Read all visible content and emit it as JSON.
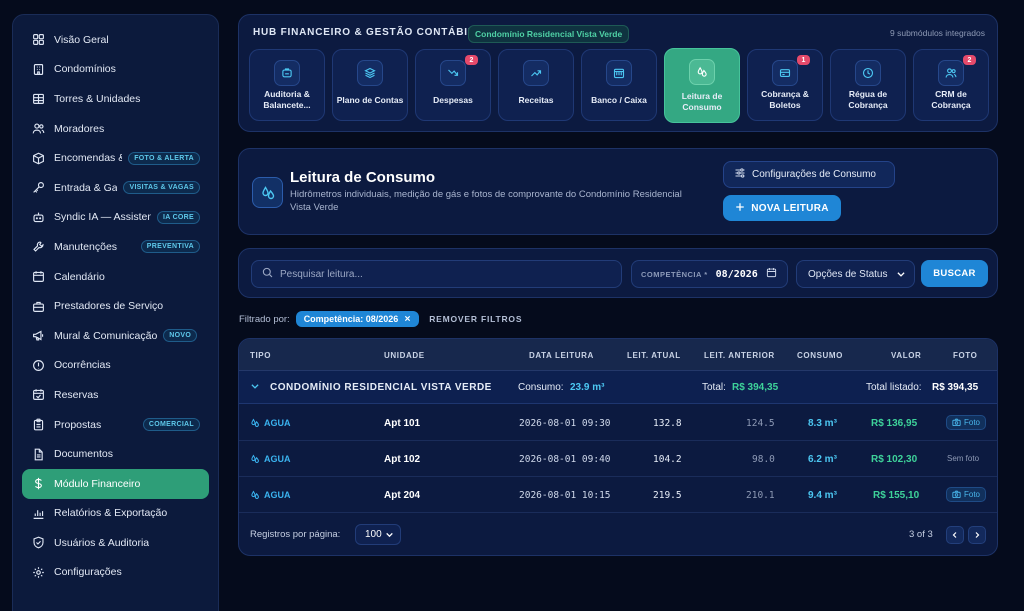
{
  "sidebar": {
    "items": [
      {
        "label": "Visão Geral",
        "icon": "grid-icon"
      },
      {
        "label": "Condomínios",
        "icon": "building-icon"
      },
      {
        "label": "Torres & Unidades",
        "icon": "tower-icon"
      },
      {
        "label": "Moradores",
        "icon": "users-icon"
      },
      {
        "label": "Encomendas &...",
        "icon": "package-icon",
        "badge": "FOTO & ALERTA"
      },
      {
        "label": "Entrada & Gar...",
        "icon": "key-icon",
        "badge": "VISITAS & VAGAS"
      },
      {
        "label": "Syndic IA — Assistente",
        "icon": "bot-icon",
        "badge": "IA CORE"
      },
      {
        "label": "Manutenções",
        "icon": "wrench-icon",
        "badge": "PREVENTIVA"
      },
      {
        "label": "Calendário",
        "icon": "calendar-icon"
      },
      {
        "label": "Prestadores de Serviço",
        "icon": "briefcase-icon"
      },
      {
        "label": "Mural & Comunicação",
        "icon": "megaphone-icon",
        "badge": "NOVO"
      },
      {
        "label": "Ocorrências",
        "icon": "alert-icon"
      },
      {
        "label": "Reservas",
        "icon": "calendar-check-icon"
      },
      {
        "label": "Propostas",
        "icon": "clipboard-icon",
        "badge": "COMERCIAL"
      },
      {
        "label": "Documentos",
        "icon": "file-icon"
      },
      {
        "label": "Módulo Financeiro",
        "icon": "dollar-icon",
        "active": true
      },
      {
        "label": "Relatórios & Exportação",
        "icon": "chart-icon"
      },
      {
        "label": "Usuários & Auditoria",
        "icon": "shield-icon"
      },
      {
        "label": "Configurações",
        "icon": "gear-icon"
      }
    ]
  },
  "hub": {
    "title": "HUB FINANCEIRO & GESTÃO CONTÁBIL",
    "condominium": "Condomínio Residencial Vista Verde",
    "count": "9 submódulos integrados",
    "modules": [
      {
        "label": "Auditoria & Balancete...",
        "icon": "audit-icon"
      },
      {
        "label": "Plano de Contas",
        "icon": "layers-icon"
      },
      {
        "label": "Despesas",
        "icon": "trend-down-icon",
        "badge": "2"
      },
      {
        "label": "Receitas",
        "icon": "trend-up-icon"
      },
      {
        "label": "Banco / Caixa",
        "icon": "bank-icon"
      },
      {
        "label": "Leitura de Consumo",
        "icon": "droplets-icon",
        "active": true
      },
      {
        "label": "Cobrança & Boletos",
        "icon": "card-icon",
        "badge": "1"
      },
      {
        "label": "Régua de Cobrança",
        "icon": "clock-icon"
      },
      {
        "label": "CRM de Cobrança",
        "icon": "users-icon",
        "badge": "2"
      }
    ]
  },
  "header": {
    "title": "Leitura de Consumo",
    "description": "Hidrômetros individuais, medição de gás e fotos de comprovante do Condomínio Residencial Vista Verde",
    "config_label": "Configurações de Consumo",
    "new_label": "NOVA LEITURA"
  },
  "search": {
    "placeholder": "Pesquisar leitura...",
    "competencia_label": "COMPETÊNCIA *",
    "competencia_value": "08/2026",
    "status_label": "Opções de Status",
    "search_button": "BUSCAR"
  },
  "filters": {
    "label": "Filtrado por:",
    "chip": "Competência: 08/2026",
    "clear": "REMOVER FILTROS"
  },
  "table": {
    "columns": [
      "TIPO",
      "UNIDADE",
      "DATA LEITURA",
      "LEIT. ATUAL",
      "LEIT. ANTERIOR",
      "CONSUMO",
      "VALOR",
      "FOTO"
    ],
    "group": {
      "name": "CONDOMÍNIO RESIDENCIAL VISTA VERDE",
      "consumo_label": "Consumo:",
      "consumo_value": "23.9 m³",
      "total_label": "Total:",
      "total_value": "R$ 394,35",
      "listed_label": "Total listado:",
      "listed_value": "R$ 394,35"
    },
    "rows": [
      {
        "tipo": "AGUA",
        "unidade": "Apt 101",
        "data": "2026-08-01 09:30",
        "atual": "132.8",
        "anterior": "124.5",
        "consumo": "8.3 m³",
        "valor": "R$ 136,95",
        "foto": "Foto",
        "has_photo": true
      },
      {
        "tipo": "AGUA",
        "unidade": "Apt 102",
        "data": "2026-08-01 09:40",
        "atual": "104.2",
        "anterior": "98.0",
        "consumo": "6.2 m³",
        "valor": "R$ 102,30",
        "foto": "Sem foto",
        "has_photo": false
      },
      {
        "tipo": "AGUA",
        "unidade": "Apt 204",
        "data": "2026-08-01 10:15",
        "atual": "219.5",
        "anterior": "210.1",
        "consumo": "9.4 m³",
        "valor": "R$ 155,10",
        "foto": "Foto",
        "has_photo": true
      }
    ],
    "footer": {
      "per_page_label": "Registros por página:",
      "per_page_value": "100",
      "pagination": "3 of 3"
    }
  },
  "colors": {
    "accent_green": "#2e9e78",
    "accent_blue": "#1f86d6",
    "badge_red": "#e54a6b",
    "background": "#050b1c"
  }
}
